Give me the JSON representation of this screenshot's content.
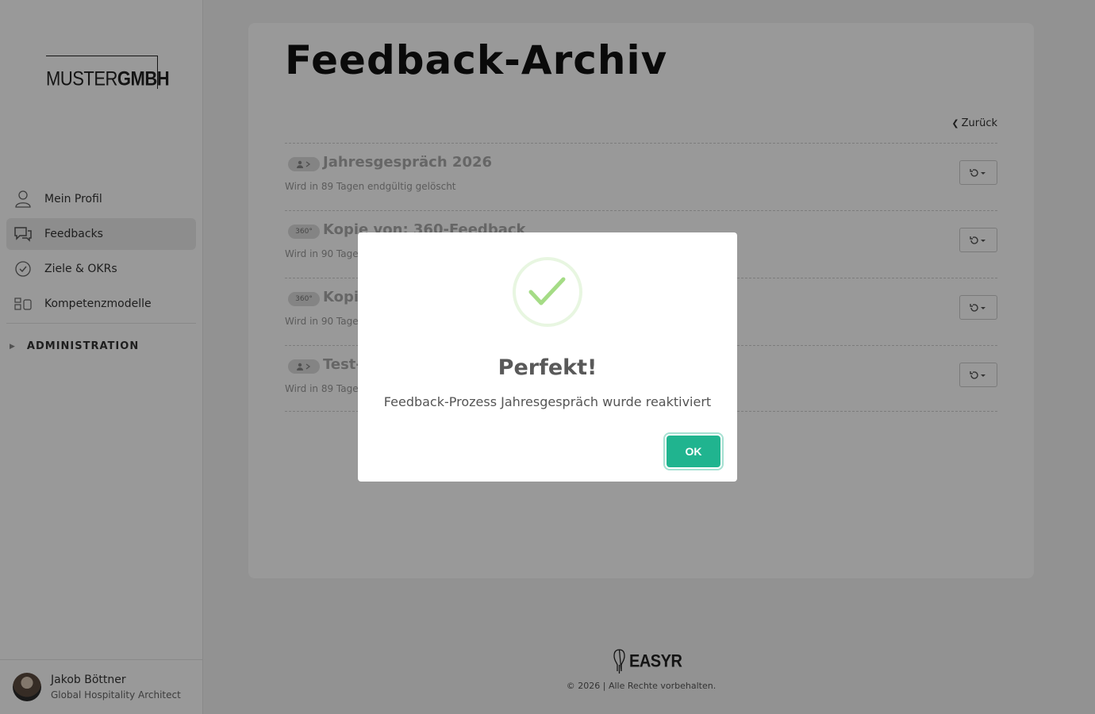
{
  "brand": {
    "logo_light": "MUSTER",
    "logo_bold": "GMBH"
  },
  "sidebar": {
    "items": [
      {
        "label": "Mein Profil",
        "icon": "user-icon"
      },
      {
        "label": "Feedbacks",
        "icon": "chat-bubbles-icon",
        "active": true
      },
      {
        "label": "Ziele & OKRs",
        "icon": "check-circle-icon"
      },
      {
        "label": "Kompetenzmodelle",
        "icon": "competency-model-icon"
      }
    ],
    "admin_label": "ADMINISTRATION",
    "user": {
      "name": "Jakob Böttner",
      "role": "Global Hospitality Architect"
    }
  },
  "main": {
    "title": "Feedback-Archiv",
    "back_label": "Zurück",
    "rows": [
      {
        "badge": "person-arrow",
        "title": "Jahresgespräch 2026",
        "subtitle": "Wird in 89 Tagen endgültig gelöscht"
      },
      {
        "badge": "360°",
        "title": "Kopie von: 360-Feedback",
        "subtitle": "Wird in 90 Tagen endgültig gelöscht"
      },
      {
        "badge": "360°",
        "title": "Kopie",
        "subtitle": "Wird in 90 Tagen endgültig gelöscht"
      },
      {
        "badge": "person-arrow",
        "title": "Test-",
        "subtitle": "Wird in 89 Tagen endgültig gelöscht"
      }
    ]
  },
  "footer": {
    "brand": "EASYR",
    "copyright": "© 2026 | Alle Rechte vorbehalten."
  },
  "modal": {
    "title": "Perfekt!",
    "message": "Feedback-Prozess Jahresgespräch wurde reaktiviert",
    "ok_label": "OK"
  },
  "colors": {
    "accent": "#20b48f",
    "success": "#a5dc86"
  }
}
